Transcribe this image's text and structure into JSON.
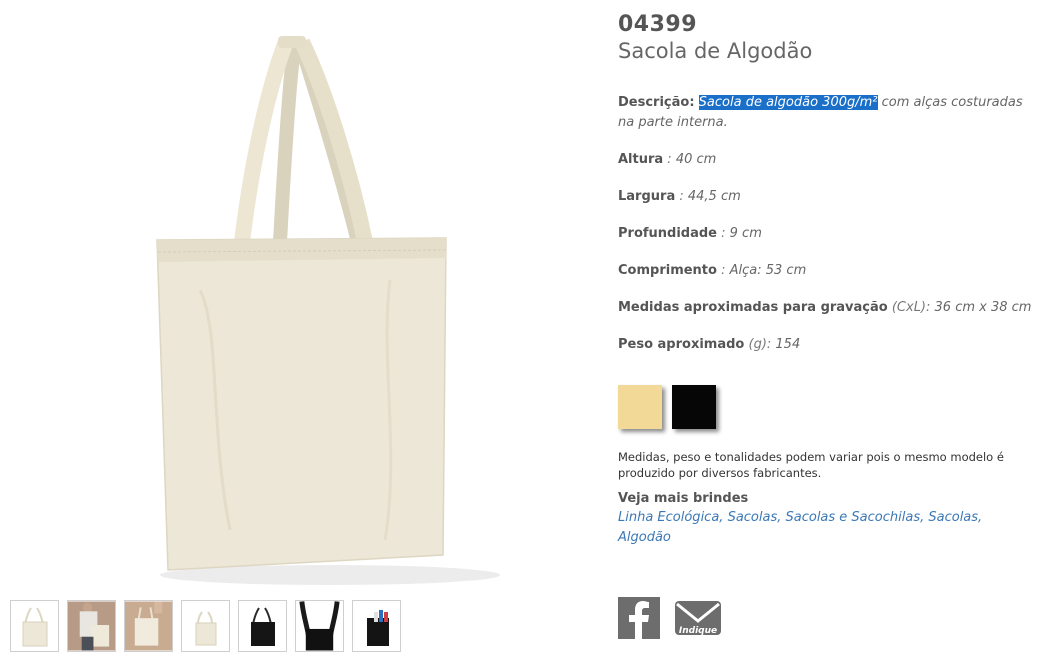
{
  "product": {
    "code": "04399",
    "name": "Sacola de Algodão"
  },
  "description": {
    "label": "Descrição:",
    "highlighted": "Sacola de algodão 300g/m²",
    "rest": " com alças costuradas na parte interna."
  },
  "specs": [
    {
      "label": "Altura",
      "sep": " : ",
      "value": "40 cm"
    },
    {
      "label": "Largura",
      "sep": " : ",
      "value": "44,5 cm"
    },
    {
      "label": "Profundidade",
      "sep": " : ",
      "value": "9 cm"
    },
    {
      "label": "Comprimento",
      "sep": " : ",
      "value": "Alça: 53 cm"
    },
    {
      "label": "Medidas aproximadas para gravação",
      "sep": " (CxL): ",
      "value": "36 cm x 38 cm"
    },
    {
      "label": "Peso aproximado",
      "sep": " (g): ",
      "value": "154"
    }
  ],
  "colors": {
    "swatches": [
      "#f2d998",
      "#060606"
    ]
  },
  "note": "Medidas, peso e tonalidades podem variar pois o mesmo modelo é produzido por diversos fabricantes.",
  "more": {
    "title": "Veja mais brindes",
    "links": [
      "Linha Ecológica",
      "Sacolas",
      "Sacolas e Sacochilas",
      "Sacolas",
      "Algodão"
    ]
  },
  "share": {
    "facebook_icon": "facebook-icon",
    "email_icon": "envelope-icon",
    "email_label": "Indique"
  },
  "thumbnails": [
    {
      "icon": "natural-bag"
    },
    {
      "icon": "person-with-bag"
    },
    {
      "icon": "hand-holding-bag"
    },
    {
      "icon": "natural-bag-small"
    },
    {
      "icon": "black-bag"
    },
    {
      "icon": "black-bag-closeup"
    },
    {
      "icon": "black-bag-with-items"
    }
  ]
}
